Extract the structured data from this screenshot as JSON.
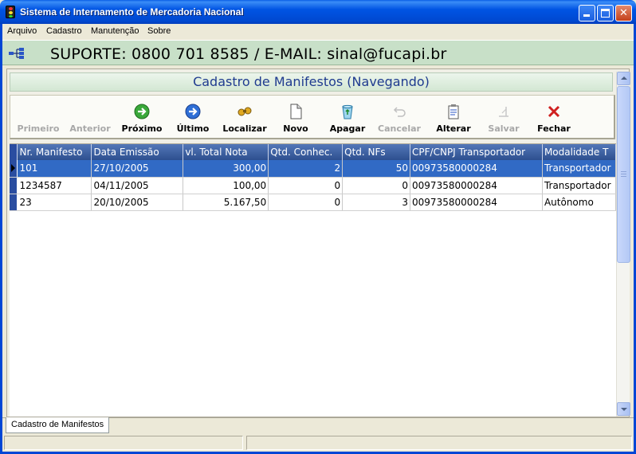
{
  "window": {
    "title": "Sistema de Internamento de Mercadoria Nacional",
    "minimize_label": "",
    "maximize_label": "",
    "close_label": "✕"
  },
  "menu": [
    "Arquivo",
    "Cadastro",
    "Manutenção",
    "Sobre"
  ],
  "support": {
    "icon": "network-icon",
    "text": "SUPORTE: 0800 701 8585 / E-MAIL: sinal@fucapi.br"
  },
  "form": {
    "title": "Cadastro de Manifestos (Navegando)"
  },
  "toolbar": [
    {
      "label": "Primeiro",
      "icon": "first-record-icon",
      "enabled": false
    },
    {
      "label": "Anterior",
      "icon": "previous-record-icon",
      "enabled": false
    },
    {
      "label": "Próximo",
      "icon": "next-record-icon",
      "enabled": true
    },
    {
      "label": "Último",
      "icon": "last-record-icon",
      "enabled": true
    },
    {
      "label": "Localizar",
      "icon": "binoculars-icon",
      "enabled": true
    },
    {
      "label": "Novo",
      "icon": "new-document-icon",
      "enabled": true
    },
    {
      "label": "Apagar",
      "icon": "recycle-bin-icon",
      "enabled": true
    },
    {
      "label": "Cancelar",
      "icon": "undo-icon",
      "enabled": false
    },
    {
      "label": "Alterar",
      "icon": "edit-clipboard-icon",
      "enabled": true
    },
    {
      "label": "Salvar",
      "icon": "save-icon",
      "enabled": false
    },
    {
      "label": "Fechar",
      "icon": "close-x-icon",
      "enabled": true
    }
  ],
  "grid": {
    "columns": [
      "Nr. Manifesto",
      "Data Emissão",
      "vl. Total Nota",
      "Qtd. Conhec.",
      "Qtd. NFs",
      "CPF/CNPJ Transportador",
      "Modalidade T"
    ],
    "rows": [
      [
        "101",
        "27/10/2005",
        "300,00",
        "2",
        "50",
        "00973580000284",
        "Transportador"
      ],
      [
        "1234587",
        "04/11/2005",
        "100,00",
        "0",
        "0",
        "00973580000284",
        "Transportador"
      ],
      [
        "23",
        "20/10/2005",
        "5.167,50",
        "0",
        "3",
        "00973580000284",
        "Autônomo"
      ]
    ],
    "selected_row": 0
  },
  "tabs": [
    "Cadastro de Manifestos"
  ],
  "colors": {
    "title_bar": "#0054e3",
    "support_banner": "#c8e0c8",
    "grid_header": "#2d4f8f",
    "selected_row": "#316ac5",
    "form_title_text": "#1f3b8f"
  }
}
